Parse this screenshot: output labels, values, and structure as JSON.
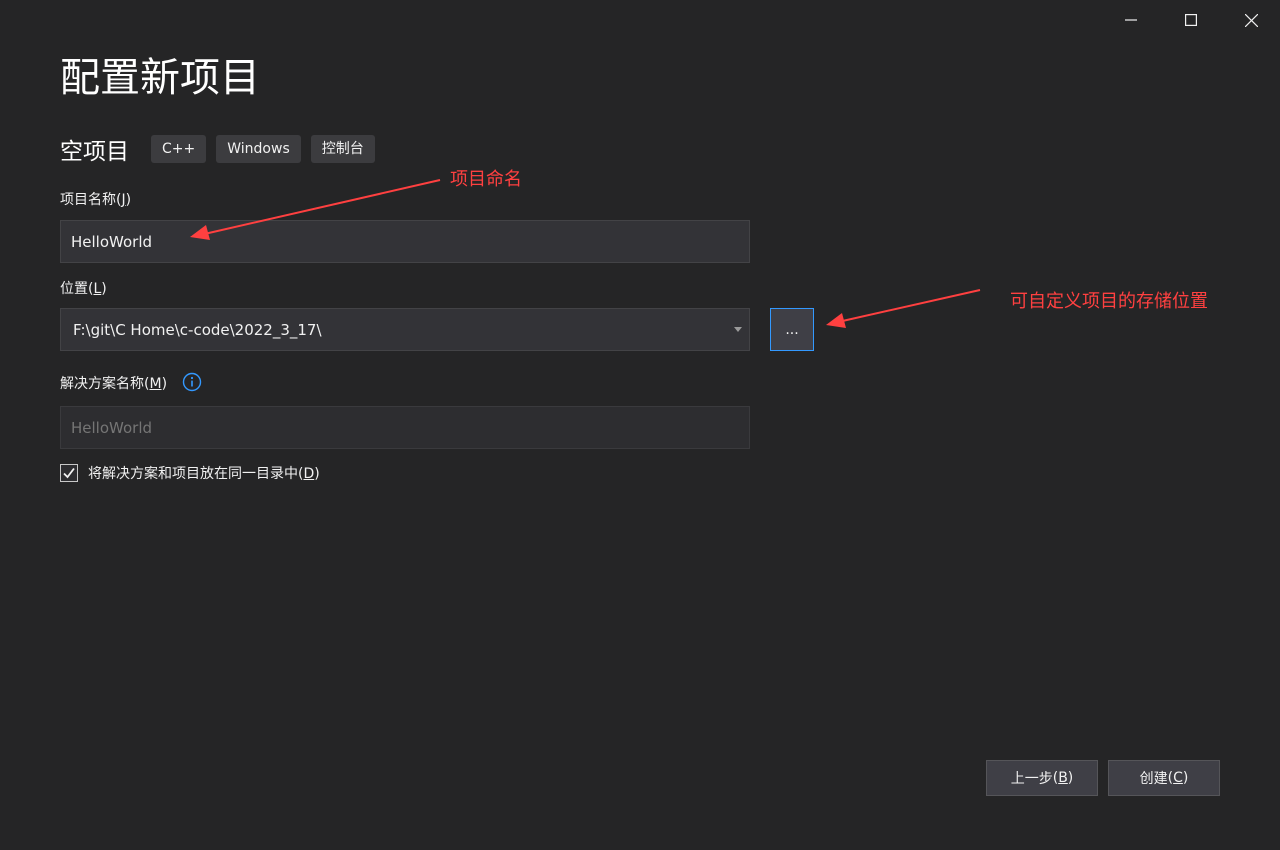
{
  "window": {
    "minimize_icon": "minimize-icon",
    "maximize_icon": "maximize-icon",
    "close_icon": "close-icon"
  },
  "page": {
    "title": "配置新项目"
  },
  "template": {
    "name": "空项目",
    "tags": [
      "C++",
      "Windows",
      "控制台"
    ]
  },
  "project_name": {
    "label": "项目名称",
    "accesskey": "J",
    "value": "HelloWorld"
  },
  "location": {
    "label": "位置",
    "accesskey": "L",
    "value": "F:\\git\\C Home\\c-code\\2022_3_17\\",
    "browse_label": "..."
  },
  "solution_name": {
    "label": "解决方案名称",
    "accesskey": "M",
    "placeholder": "HelloWorld"
  },
  "same_directory": {
    "label": "将解决方案和项目放在同一目录中",
    "accesskey": "D",
    "checked": true
  },
  "footer": {
    "back_label": "上一步",
    "back_accesskey": "B",
    "create_label": "创建",
    "create_accesskey": "C"
  },
  "annotations": {
    "project_name_note": "项目命名",
    "location_note": "可自定义项目的存储位置",
    "color": "#ff4040"
  },
  "colors": {
    "background": "#252526",
    "input_bg": "#333337",
    "accent_border": "#3399ff"
  }
}
